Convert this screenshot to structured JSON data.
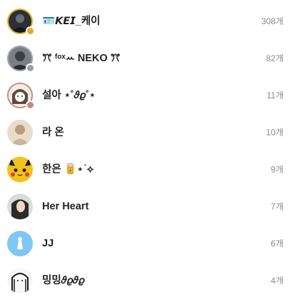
{
  "rows": [
    {
      "name": "🪪𝙆𝙀𝙄_케이",
      "count": "308개",
      "avatar": "dark-figure",
      "ring": "gold",
      "badge": true
    },
    {
      "name": "ꔫ ᶠᵒˣꕀ NEKO ꔫ",
      "count": "82개",
      "avatar": "gray-figure",
      "ring": "gray",
      "badge": true
    },
    {
      "name": "설아 ⋆˚𝜗𝜚˚⋆",
      "count": "11개",
      "avatar": "drawn-face",
      "ring": "rose",
      "badge": true
    },
    {
      "name": "라 온",
      "count": "10개",
      "avatar": "beige-figure",
      "ring": "none",
      "badge": false
    },
    {
      "name": "한은 🥫⋆˙⟡",
      "count": "9개",
      "avatar": "pikachu",
      "ring": "none",
      "badge": false
    },
    {
      "name": "Her Heart",
      "count": "7개",
      "avatar": "woman-photo",
      "ring": "none",
      "badge": false
    },
    {
      "name": "JJ",
      "count": "6개",
      "avatar": "blue-default",
      "ring": "none",
      "badge": false
    },
    {
      "name": "밍밍𝜗𝜚𝜗𝜚",
      "count": "4개",
      "avatar": "sketch-girl",
      "ring": "none",
      "badge": false
    }
  ],
  "colors": {
    "name": "#222222",
    "count": "#8a8a8a",
    "ring_gold": "#e8a92a",
    "ring_gray": "#9aa0a6",
    "ring_rose": "#c98a78"
  }
}
